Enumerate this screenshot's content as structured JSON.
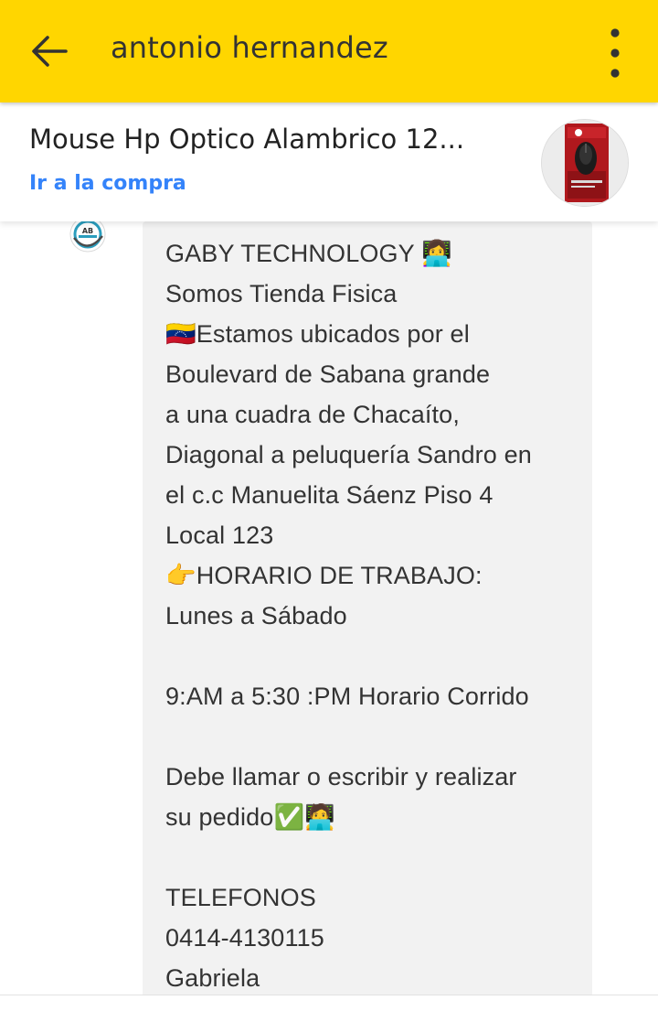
{
  "header": {
    "title": "antonio hernandez",
    "back_icon": "arrow-left-icon",
    "menu_icon": "more-vert-icon"
  },
  "product": {
    "title": "Mouse Hp Optico Alambrico 12...",
    "link_label": "Ir a la compra",
    "thumbnail_icon": "mouse-box-image"
  },
  "message": {
    "sender_avatar_text": "AB",
    "text": "GABY TECHNOLOGY 👩‍💻\nSomos Tienda Fisica\n🇻🇪Estamos ubicados por el\nBoulevard de Sabana grande\na una cuadra de Chacaíto,\nDiagonal a peluquería Sandro en\nel c.c Manuelita Sáenz Piso 4\nLocal 123\n👉HORARIO DE TRABAJO:\nLunes a Sábado\n\n9:AM a 5:30 :PM Horario Corrido\n\nDebe llamar o escribir y realizar\nsu pedido✅🧑‍💻\n\nTELEFONOS\n0414-4130115\nGabriela"
  },
  "colors": {
    "appbar": "#ffd600",
    "link": "#3483fa",
    "bubble": "#f2f2f2",
    "text": "#333333"
  }
}
